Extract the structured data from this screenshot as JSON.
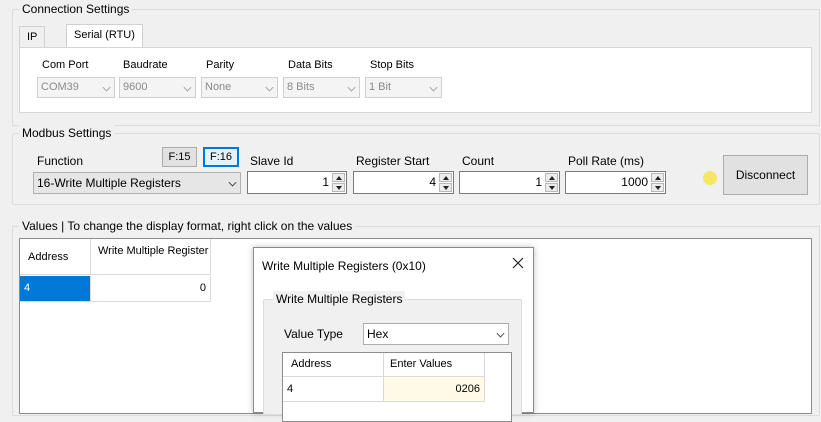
{
  "connection": {
    "title": "Connection Settings",
    "tabs": [
      {
        "label": "IP"
      },
      {
        "label": "Serial (RTU)"
      }
    ],
    "fields": [
      {
        "label": "Com Port",
        "value": "COM39"
      },
      {
        "label": "Baudrate",
        "value": "9600"
      },
      {
        "label": "Parity",
        "value": "None"
      },
      {
        "label": "Data Bits",
        "value": "8 Bits"
      },
      {
        "label": "Stop Bits",
        "value": "1 Bit"
      }
    ]
  },
  "modbus": {
    "title": "Modbus Settings",
    "function_label": "Function",
    "function_value": "16-Write Multiple Registers",
    "f15_label": "F:15",
    "f16_label": "F:16",
    "slave_id": {
      "label": "Slave Id",
      "value": "1"
    },
    "register_start": {
      "label": "Register Start",
      "value": "4"
    },
    "count": {
      "label": "Count",
      "value": "1"
    },
    "poll_rate": {
      "label": "Poll Rate (ms)",
      "value": "1000"
    },
    "status_color": "#f5e663",
    "disconnect_label": "Disconnect"
  },
  "values": {
    "title": "Values | To change the display format, right click on the values",
    "columns": [
      "Address",
      "Write Multiple Register"
    ],
    "rows": [
      {
        "address": "4",
        "value": "0"
      }
    ]
  },
  "dialog": {
    "title": "Write Multiple Registers (0x10)",
    "group_title": "Write Multiple Registers",
    "value_type_label": "Value Type",
    "value_type_value": "Hex",
    "columns": [
      "Address",
      "Enter Values"
    ],
    "rows": [
      {
        "address": "4",
        "value": "0206"
      }
    ]
  },
  "colors": {
    "selection": "#0078d7",
    "edit_cell": "#fffbe6"
  }
}
